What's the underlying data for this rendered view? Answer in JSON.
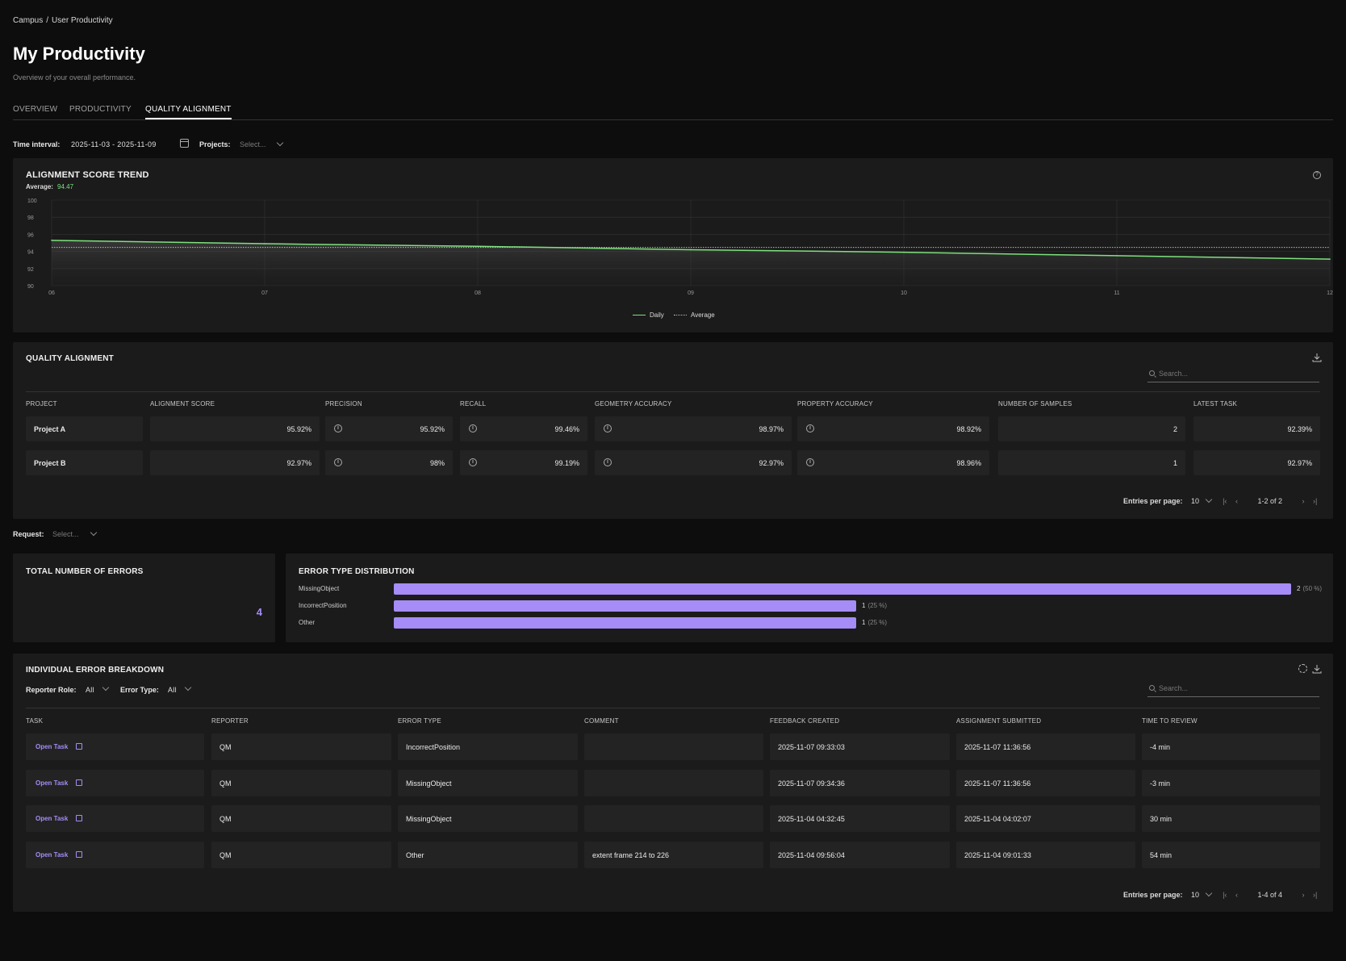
{
  "breadcrumb": [
    "Campus",
    "/",
    "User Productivity"
  ],
  "page": {
    "title": "My Productivity",
    "subtitle": "Overview of your overall performance."
  },
  "tabs": [
    {
      "label": "OVERVIEW"
    },
    {
      "label": "PRODUCTIVITY"
    },
    {
      "label": "QUALITY ALIGNMENT",
      "active": true
    }
  ],
  "filters": {
    "time_label": "Time interval:",
    "time_value": "2025-11-03 - 2025-11-09",
    "projects_label": "Projects:",
    "projects_placeholder": "Select...",
    "request_label": "Request:",
    "request_placeholder": "Select..."
  },
  "trend": {
    "title": "ALIGNMENT SCORE TREND",
    "average_label": "Average:",
    "average_value": "94.47",
    "colors": {
      "daily": "#7ee07e",
      "average": "#bbbbbb"
    }
  },
  "chart_data": {
    "type": "line",
    "title": "ALIGNMENT SCORE TREND",
    "x": [
      "06",
      "07",
      "08",
      "09",
      "10",
      "11",
      "12"
    ],
    "ylim": [
      90,
      100
    ],
    "yticks": [
      "100",
      "98",
      "96",
      "94",
      "92",
      "90"
    ],
    "series": [
      {
        "name": "Daily",
        "values": [
          95.3,
          94.9,
          94.6,
          94.2,
          93.9,
          93.5,
          93.1
        ]
      },
      {
        "name": "Average",
        "values": [
          94.47,
          94.47,
          94.47,
          94.47,
          94.47,
          94.47,
          94.47
        ]
      }
    ],
    "grid": true,
    "legend": "bottom-center"
  },
  "quality": {
    "title": "QUALITY ALIGNMENT",
    "search_placeholder": "Search...",
    "columns": [
      "PROJECT",
      "ALIGNMENT SCORE",
      "PRECISION",
      "RECALL",
      "GEOMETRY ACCURACY",
      "PROPERTY ACCURACY",
      "NUMBER OF SAMPLES",
      "LATEST TASK"
    ],
    "rows": [
      {
        "project": "Project A",
        "alignment": "95.92%",
        "precision": "95.92%",
        "recall": "99.46%",
        "geometry": "98.97%",
        "property": "98.92%",
        "samples": "2",
        "latest": "92.39%"
      },
      {
        "project": "Project B",
        "alignment": "92.97%",
        "precision": "98%",
        "recall": "99.19%",
        "geometry": "92.97%",
        "property": "98.96%",
        "samples": "1",
        "latest": "92.97%"
      }
    ],
    "pager": {
      "label": "Entries per page:",
      "per_page": "10",
      "range": "1-2 of 2"
    }
  },
  "errors_total": {
    "title": "TOTAL NUMBER OF ERRORS",
    "value": "4",
    "color": "#a58cf7"
  },
  "error_dist": {
    "title": "ERROR TYPE DISTRIBUTION",
    "items": [
      {
        "label": "MissingObject",
        "count": "2",
        "pct": "(50 %)",
        "fraction": 1.0
      },
      {
        "label": "IncorrectPosition",
        "count": "1",
        "pct": "(25 %)",
        "fraction": 0.5155
      },
      {
        "label": "Other",
        "count": "1",
        "pct": "(25 %)",
        "fraction": 0.5155
      }
    ]
  },
  "breakdown": {
    "title": "INDIVIDUAL ERROR BREAKDOWN",
    "reporter_label": "Reporter Role:",
    "reporter_value": "All",
    "error_type_label": "Error Type:",
    "error_type_value": "All",
    "search_placeholder": "Search...",
    "columns": [
      "TASK",
      "REPORTER",
      "ERROR TYPE",
      "COMMENT",
      "FEEDBACK CREATED",
      "ASSIGNMENT SUBMITTED",
      "TIME TO REVIEW"
    ],
    "rows": [
      {
        "task": "Open Task",
        "reporter": "QM",
        "error_type": "IncorrectPosition",
        "comment": "",
        "feedback": "2025-11-07 09:33:03",
        "submitted": "2025-11-07 11:36:56",
        "review": "-4 min"
      },
      {
        "task": "Open Task",
        "reporter": "QM",
        "error_type": "MissingObject",
        "comment": "",
        "feedback": "2025-11-07 09:34:36",
        "submitted": "2025-11-07 11:36:56",
        "review": "-3 min"
      },
      {
        "task": "Open Task",
        "reporter": "QM",
        "error_type": "MissingObject",
        "comment": "",
        "feedback": "2025-11-04 04:32:45",
        "submitted": "2025-11-04 04:02:07",
        "review": "30 min"
      },
      {
        "task": "Open Task",
        "reporter": "QM",
        "error_type": "Other",
        "comment": "extent frame 214 to 226",
        "feedback": "2025-11-04 09:56:04",
        "submitted": "2025-11-04 09:01:33",
        "review": "54 min"
      }
    ],
    "pager": {
      "label": "Entries per page:",
      "per_page": "10",
      "range": "1-4 of 4"
    }
  }
}
